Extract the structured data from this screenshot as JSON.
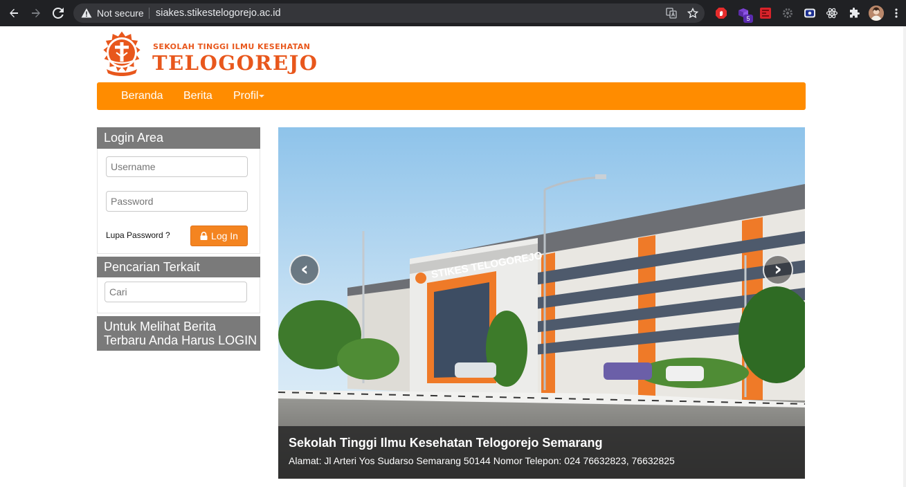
{
  "browser": {
    "security_label": "Not secure",
    "url": "siakes.stikestelogorejo.ac.id",
    "extension_badge": "5"
  },
  "site": {
    "subtitle": "SEKOLAH TINGGI ILMU KESEHATAN",
    "name": "TELOGOREJO",
    "accent_color": "#ff8c00",
    "brand_color": "#e8571c"
  },
  "nav": {
    "items": [
      {
        "label": "Beranda"
      },
      {
        "label": "Berita"
      },
      {
        "label": "Profil",
        "has_dropdown": true
      }
    ]
  },
  "login": {
    "title": "Login Area",
    "username_placeholder": "Username",
    "password_placeholder": "Password",
    "forgot_label": "Lupa Password ?",
    "button_label": "Log In"
  },
  "search": {
    "title": "Pencarian Terkait",
    "placeholder": "Cari"
  },
  "notice": {
    "line1": "Untuk Melihat Berita",
    "line2": "Terbaru Anda Harus LOGIN"
  },
  "carousel": {
    "building_sign": "STIKES TELOGOREJO",
    "caption_title": "Sekolah Tinggi Ilmu Kesehatan Telogorejo Semarang",
    "caption_text": "Alamat: Jl Arteri Yos Sudarso Semarang 50144 Nomor Telepon: 024 76632823, 76632825",
    "prev_icon": "chevron-left",
    "next_icon": "chevron-right"
  }
}
